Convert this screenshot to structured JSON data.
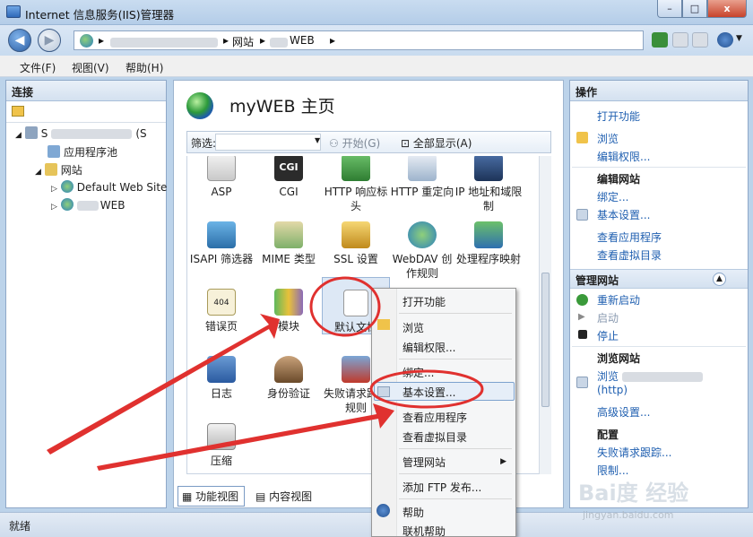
{
  "window": {
    "title": "Internet 信息服务(IIS)管理器",
    "close": "x",
    "minimize": "–",
    "maximize": "□"
  },
  "address": {
    "segments": [
      "网站",
      "WEB"
    ]
  },
  "menu": {
    "file": "文件(F)",
    "view": "视图(V)",
    "help": "帮助(H)"
  },
  "connections": {
    "header": "连接",
    "tree": [
      {
        "label": "S",
        "suffix": "(S"
      },
      {
        "label": "应用程序池"
      },
      {
        "label": "网站"
      },
      {
        "label": "Default Web Site"
      },
      {
        "label": "WEB"
      }
    ]
  },
  "center": {
    "title": "myWEB 主页",
    "filter_label": "筛选:",
    "start_label": "开始(G)",
    "show_all_label": "全部显示(A)",
    "features": [
      {
        "label": "ASP",
        "icon": "asp-icon"
      },
      {
        "label": "CGI",
        "icon": "cgi-icon"
      },
      {
        "label": "HTTP 响应标头",
        "icon": "http-response-icon"
      },
      {
        "label": "HTTP 重定向",
        "icon": "http-redirect-icon"
      },
      {
        "label": "IP 地址和域限制",
        "icon": "ip-restrict-icon"
      },
      {
        "label": "ISAPI 筛选器",
        "icon": "isapi-icon"
      },
      {
        "label": "MIME 类型",
        "icon": "mime-icon"
      },
      {
        "label": "SSL 设置",
        "icon": "lock-icon"
      },
      {
        "label": "WebDAV 创作规则",
        "icon": "webdav-icon"
      },
      {
        "label": "处理程序映射",
        "icon": "handler-icon"
      },
      {
        "label": "错误页",
        "icon": "error-page-icon"
      },
      {
        "label": "模块",
        "icon": "modules-icon"
      },
      {
        "label": "默认文档",
        "icon": "default-doc-icon"
      },
      {
        "label": "日志",
        "icon": "log-icon"
      },
      {
        "label": "身份验证",
        "icon": "auth-icon"
      },
      {
        "label": "失败请求跟踪规则",
        "icon": "failed-request-icon"
      },
      {
        "label": "压缩",
        "icon": "compress-icon"
      }
    ],
    "tab_features": "功能视图",
    "tab_content": "内容视图"
  },
  "actions": {
    "header": "操作",
    "open_feature": "打开功能",
    "browse": "浏览",
    "edit_permissions": "编辑权限...",
    "edit_site": "编辑网站",
    "bindings": "绑定...",
    "basic_settings": "基本设置...",
    "view_applications": "查看应用程序",
    "view_virtual_dirs": "查看虚拟目录",
    "manage_site": "管理网站",
    "restart": "重新启动",
    "start": "启动",
    "stop": "停止",
    "browse_site": "浏览网站",
    "browse_prefix": "浏览",
    "http": "(http)",
    "advanced_settings": "高级设置...",
    "configure": "配置",
    "failed_tracing": "失败请求跟踪...",
    "limits": "限制..."
  },
  "context_menu": {
    "items": [
      "打开功能",
      "浏览",
      "编辑权限...",
      "绑定...",
      "基本设置...",
      "查看应用程序",
      "查看虚拟目录",
      "管理网站",
      "添加 FTP 发布...",
      "帮助",
      "联机帮助"
    ]
  },
  "status": {
    "text": "就绪"
  },
  "watermark": {
    "main": "Bai度 经验",
    "sub": "jingyan.baidu.com"
  },
  "colors": {
    "annotation": "#e0312f",
    "link": "#1f5fb0",
    "highlight": "#e6eef8"
  }
}
